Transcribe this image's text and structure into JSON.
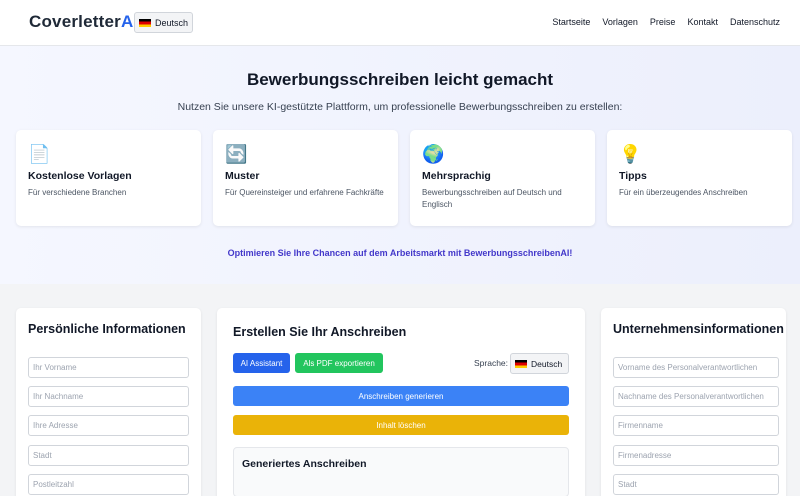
{
  "header": {
    "logo_main": "Coverletter",
    "logo_ai": "AI",
    "language": "Deutsch",
    "nav": [
      "Startseite",
      "Vorlagen",
      "Preise",
      "Kontakt",
      "Datenschutz"
    ]
  },
  "hero": {
    "title": "Bewerbungsschreiben leicht gemacht",
    "subtitle": "Nutzen Sie unsere KI-gestützte Plattform, um professionelle Bewerbungsschreiben zu erstellen:",
    "features": [
      {
        "icon": "📄",
        "title": "Kostenlose Vorlagen",
        "desc": "Für verschiedene Branchen"
      },
      {
        "icon": "🔄",
        "title": "Muster",
        "desc": "Für Quereinsteiger und erfahrene Fachkräfte"
      },
      {
        "icon": "🌍",
        "title": "Mehrsprachig",
        "desc": "Bewerbungsschreiben auf Deutsch und Englisch"
      },
      {
        "icon": "💡",
        "title": "Tipps",
        "desc": "Für ein überzeugendes Anschreiben"
      }
    ],
    "tagline": "Optimieren Sie Ihre Chancen auf dem Arbeitsmarkt mit BewerbungsschreibenAI!"
  },
  "personal": {
    "title": "Persönliche Informationen",
    "fields": [
      "Ihr Vorname",
      "Ihr Nachname",
      "Ihre Adresse",
      "Stadt",
      "Postleitzahl"
    ]
  },
  "editor": {
    "title": "Erstellen Sie Ihr Anschreiben",
    "ai_button": "AI Assistant",
    "pdf_button": "Als PDF exportieren",
    "language_label": "Sprache:",
    "language_value": "Deutsch",
    "generate_button": "Anschreiben generieren",
    "clear_button": "Inhalt löschen",
    "generated_title": "Generiertes Anschreiben"
  },
  "company": {
    "title": "Unternehmensinformationen",
    "fields": [
      "Vorname des Personalverantwortlichen",
      "Nachname des Personalverantwortlichen",
      "Firmenname",
      "Firmenadresse",
      "Stadt"
    ]
  },
  "colors": {
    "accent": "#2563eb",
    "green": "#22c55e",
    "yellow": "#eab308",
    "tagline": "#4338ca"
  }
}
